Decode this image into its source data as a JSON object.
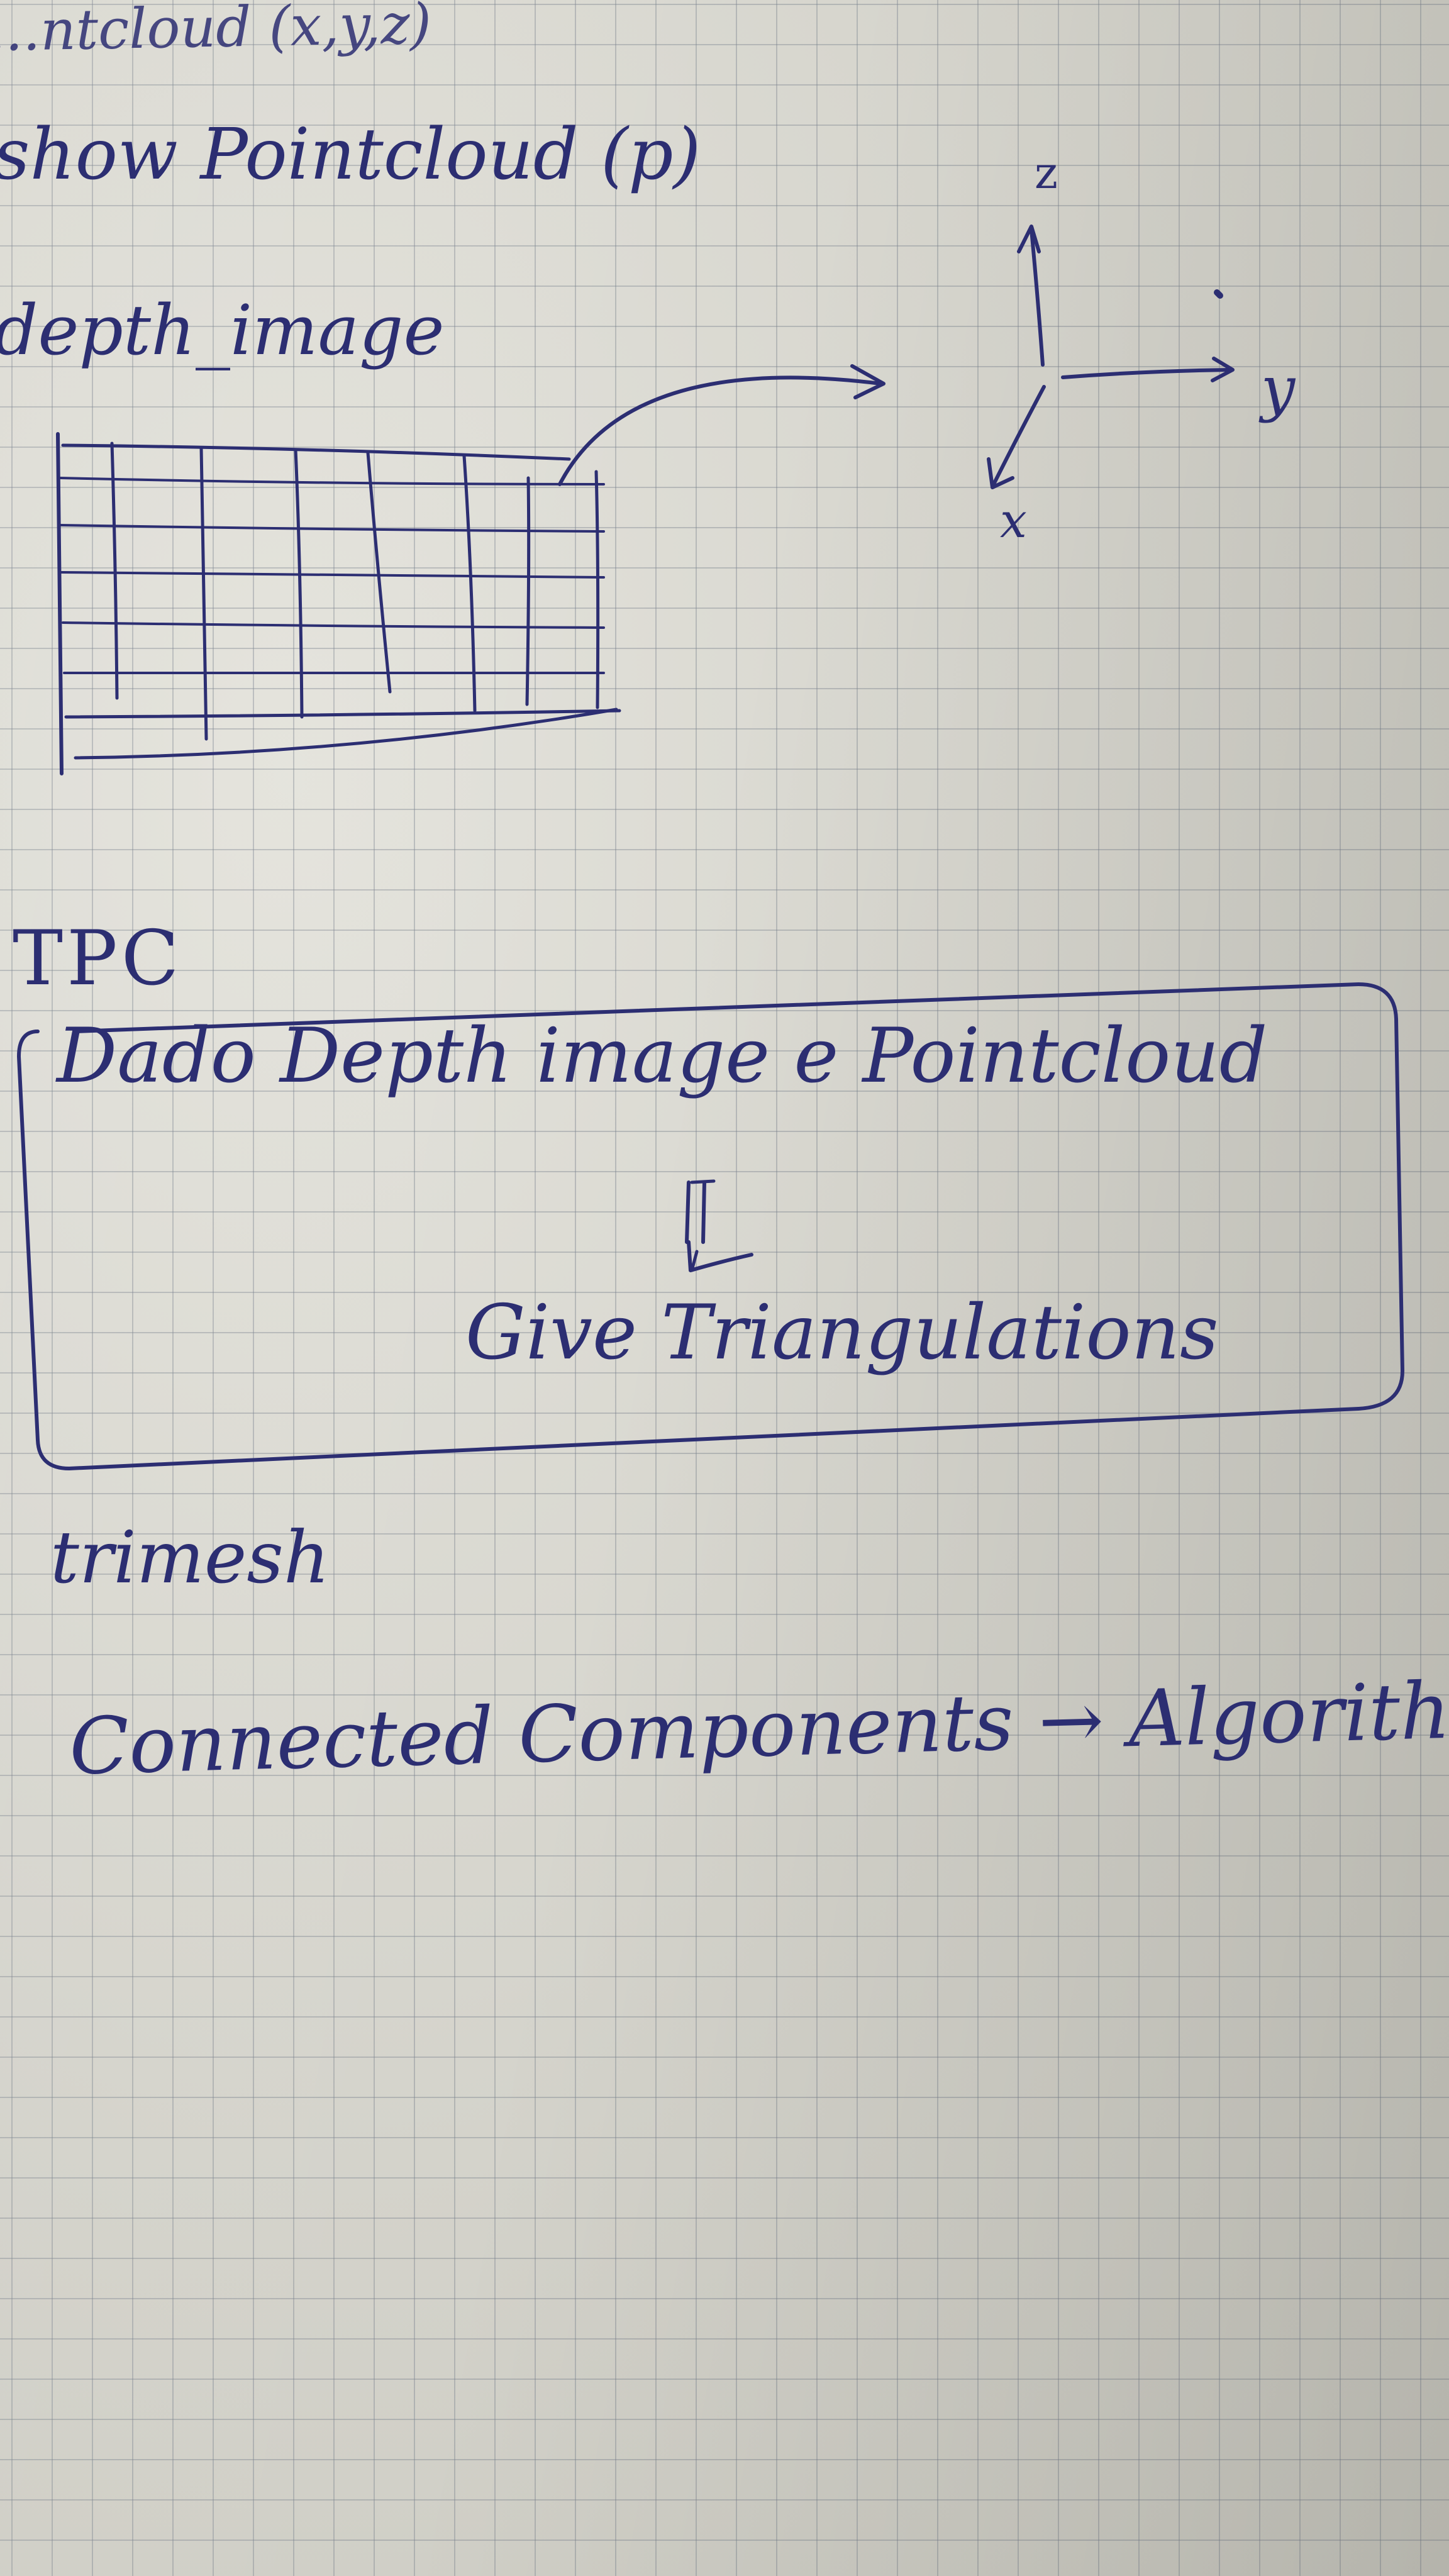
{
  "notes": {
    "line_top": "...ntcloud (x,y,z)",
    "line_show": "show Pointcloud (p)",
    "line_depth": "depth_image",
    "axis_z": "z",
    "axis_y": "y",
    "axis_x": "x",
    "heading_tpc": "TPC",
    "box_line1": "Dado Depth image e Pointcloud",
    "box_line2": "Give Triangulations",
    "line_timesh": "trimesh",
    "line_connected": "Connected Components → Algorithm ."
  },
  "colors": {
    "ink": "#2c2e72",
    "paper": "#dcdbd4",
    "grid": "#78808c"
  }
}
